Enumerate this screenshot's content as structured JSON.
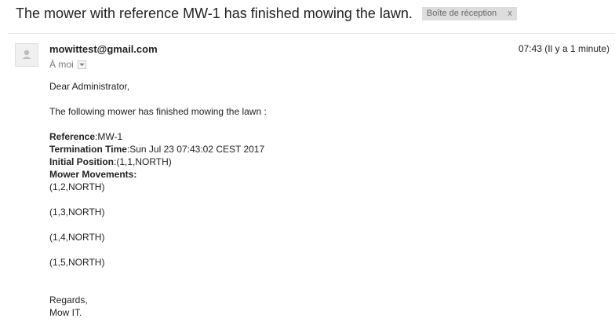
{
  "email": {
    "subject": "The mower with reference MW-1 has finished mowing the lawn.",
    "label": "Boîte de réception",
    "label_close": "x",
    "sender": "mowittest@gmail.com",
    "to": "À moi",
    "time": "07:43 (Il y a 1 minute)"
  },
  "body": {
    "greeting": "Dear Administrator,",
    "intro": "The following mower has finished mowing the lawn :",
    "reference_label": "Reference",
    "reference_value": ":MW-1",
    "termination_label": "Termination Time",
    "termination_value": ":Sun Jul 23 07:43:02 CEST 2017",
    "initial_label": "Initial Position",
    "initial_value": ":(1,1,NORTH)",
    "movements_label": "Mower Movements:",
    "movements": [
      "(1,2,NORTH)",
      "(1,3,NORTH)",
      "(1,4,NORTH)",
      "(1,5,NORTH)"
    ],
    "regards": "Regards,",
    "signature": "Mow IT."
  },
  "icons": {
    "avatar": "person-silhouette-icon",
    "dropdown": "caret-down-icon"
  }
}
